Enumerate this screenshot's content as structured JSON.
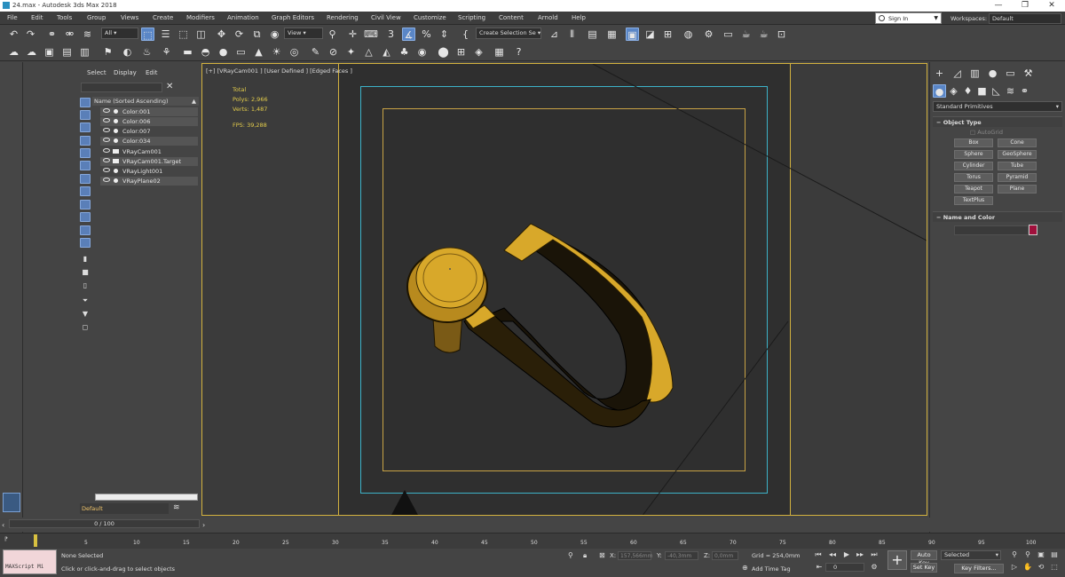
{
  "window": {
    "title": "24.max - Autodesk 3ds Max 2018",
    "min": "—",
    "max": "❐",
    "close": "✕"
  },
  "menu": [
    "File",
    "Edit",
    "Tools",
    "Group",
    "Views",
    "Create",
    "Modifiers",
    "Animation",
    "Graph Editors",
    "Rendering",
    "Civil View",
    "Customize",
    "Scripting",
    "Content",
    "Arnold",
    "Help"
  ],
  "account": {
    "signin": "Sign In",
    "workspaces_label": "Workspaces:",
    "workspace": "Default"
  },
  "toolbar": {
    "filter": "All",
    "refcoord": "View",
    "selset": "Create Selection Se"
  },
  "explorer": {
    "tabs": [
      "Select",
      "Display",
      "Edit"
    ],
    "column_header": "Name (Sorted Ascending)",
    "items": [
      {
        "name": "Color:001",
        "type": "dot"
      },
      {
        "name": "Color:006",
        "type": "dot"
      },
      {
        "name": "Color:007",
        "type": "dot"
      },
      {
        "name": "Color:034",
        "type": "dot"
      },
      {
        "name": "VRayCam001",
        "type": "cam"
      },
      {
        "name": "VRayCam001.Target",
        "type": "cam"
      },
      {
        "name": "VRayLight001",
        "type": "light"
      },
      {
        "name": "VRayPlane02",
        "type": "dot"
      }
    ],
    "layer": "Default"
  },
  "viewport": {
    "label": "[+] [VRayCam001 ] [User Defined ] [Edged Faces ]",
    "stats": {
      "total_label": "Total",
      "polys_label": "Polys:",
      "polys": "2,966",
      "verts_label": "Verts:",
      "verts": "1,487",
      "fps_label": "FPS:",
      "fps": "39,288"
    },
    "object_color": "#d8a82a"
  },
  "command_panel": {
    "primitives": "Standard Primitives",
    "object_type": "Object Type",
    "autogrid": "AutoGrid",
    "buttons": [
      "Box",
      "Cone",
      "Sphere",
      "GeoSphere",
      "Cylinder",
      "Tube",
      "Torus",
      "Pyramid",
      "Teapot",
      "Plane",
      "TextPlus"
    ],
    "name_and_color": "Name and Color",
    "swatch_color": "#a0103c"
  },
  "timeline": {
    "frame": "0 / 100",
    "ticks": [
      "5",
      "10",
      "15",
      "20",
      "25",
      "30",
      "35",
      "40",
      "45",
      "50",
      "55",
      "60",
      "65",
      "70",
      "75",
      "80",
      "85",
      "90",
      "95",
      "100"
    ]
  },
  "status": {
    "maxscript": "MAXScript Mi",
    "line1": "None Selected",
    "line2": "Click or click-and-drag to select objects",
    "x_label": "X:",
    "x": "157,566mm",
    "y_label": "Y:",
    "y": "-40,3mm",
    "z_label": "Z:",
    "z": "0,0mm",
    "grid": "Grid = 254,0mm",
    "add_time_tag": "Add Time Tag",
    "frame_spinner": "0",
    "auto_key": "Auto Key",
    "set_key": "Set Key",
    "selected": "Selected",
    "key_filters": "Key Filters..."
  }
}
